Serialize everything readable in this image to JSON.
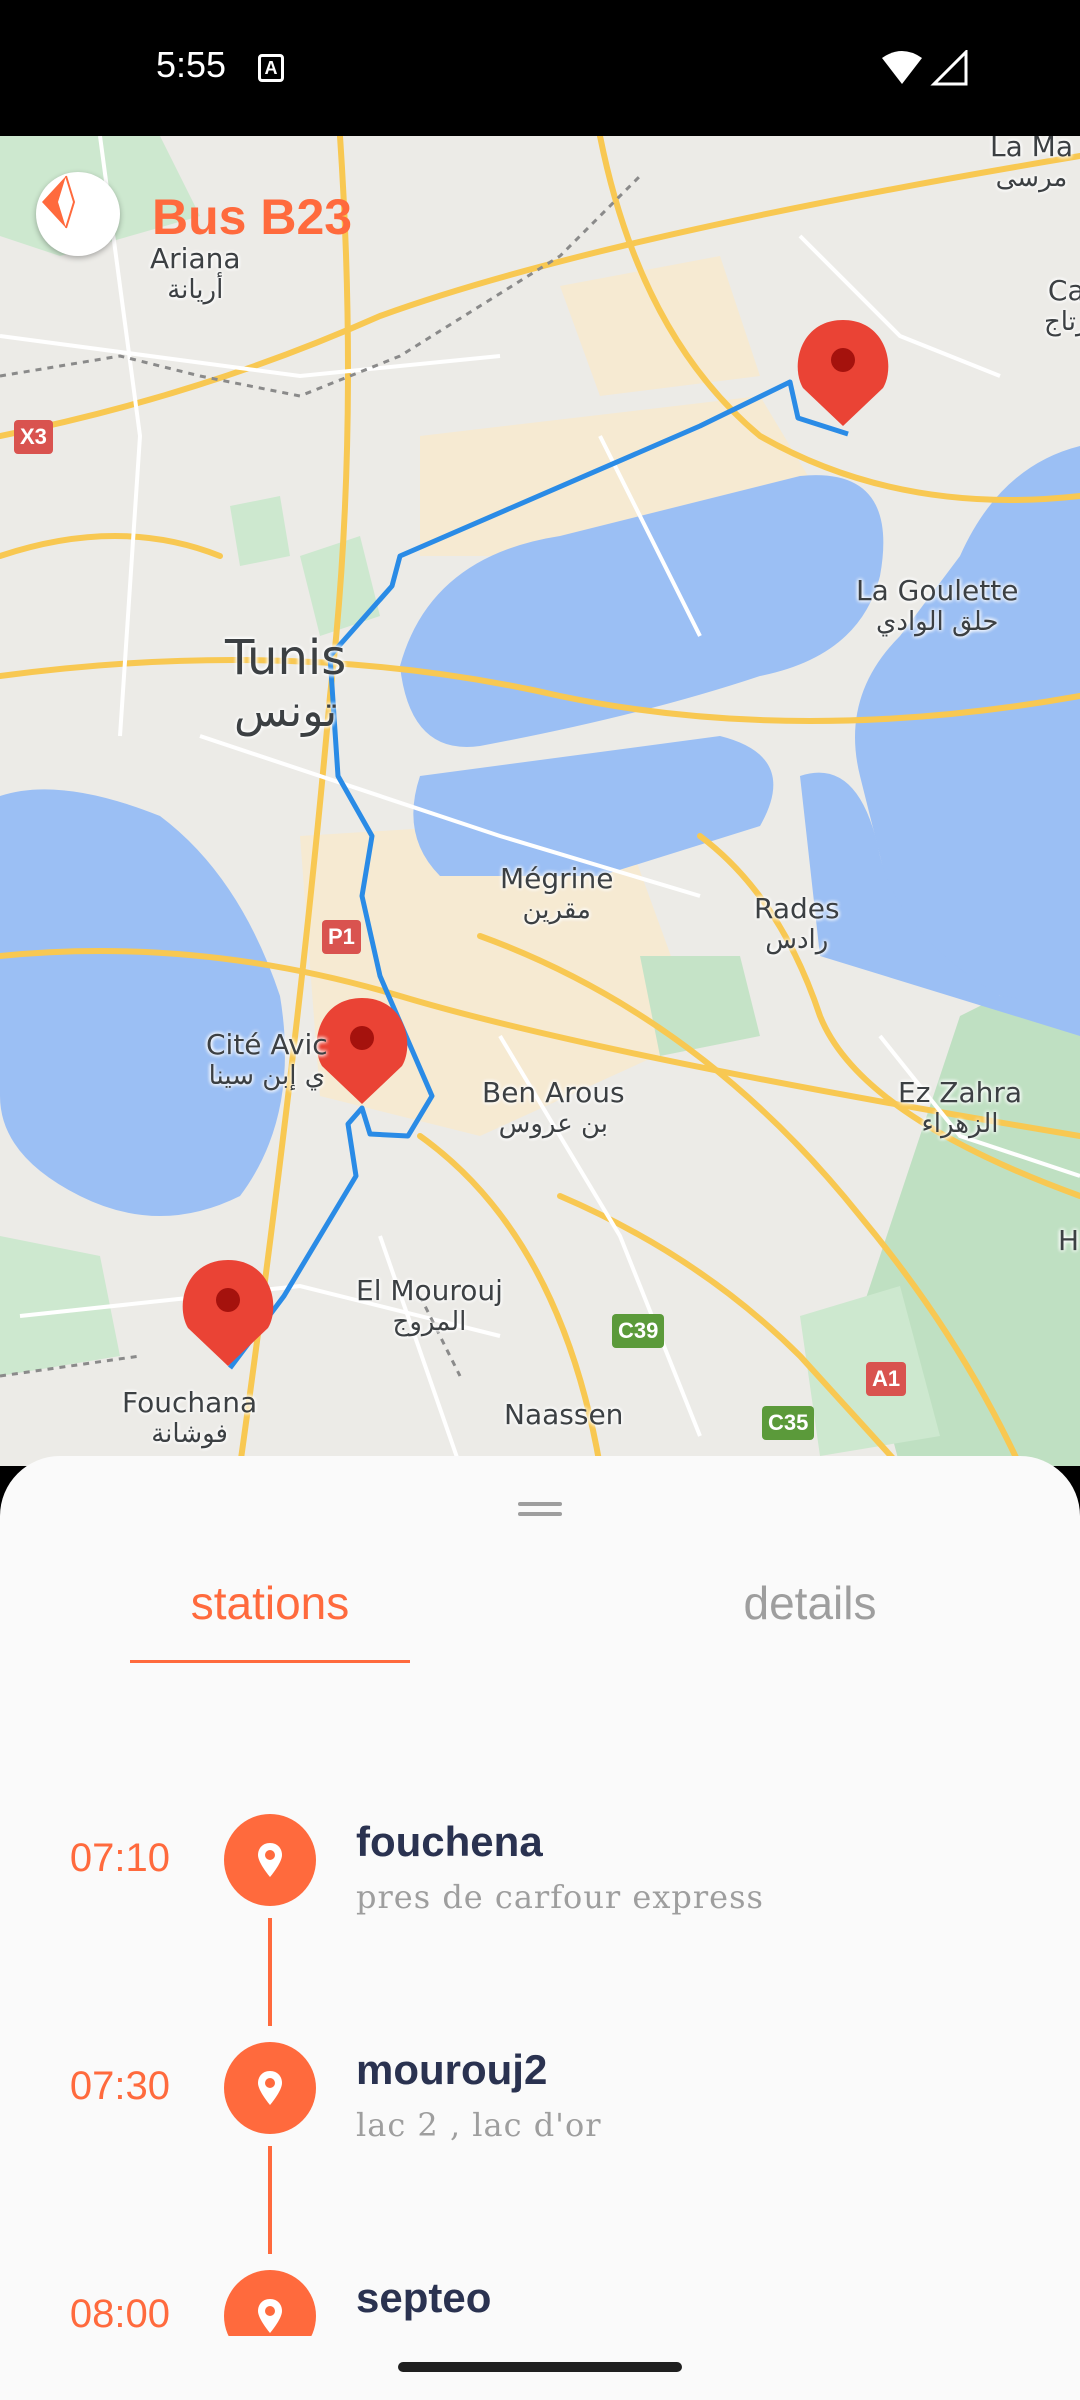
{
  "status_bar": {
    "time": "5:55",
    "notification_icon": "A"
  },
  "app": {
    "title": "Bus B23",
    "accent_color": "#ff6a3d"
  },
  "map": {
    "labels": {
      "ariana": {
        "latin": "Ariana",
        "arabic": "أريانة"
      },
      "tunis": {
        "latin": "Tunis",
        "arabic": "تونس"
      },
      "la_goulette": {
        "latin": "La Goulette",
        "arabic": "حلق الوادي"
      },
      "megrine": {
        "latin": "Mégrine",
        "arabic": "مقرين"
      },
      "rades": {
        "latin": "Rades",
        "arabic": "رادس"
      },
      "cite_avicenne": {
        "latin": "Cité Avic",
        "arabic": "ي إبن سينا"
      },
      "ben_arous": {
        "latin": "Ben Arous",
        "arabic": "بن عروس"
      },
      "ez_zahra": {
        "latin": "Ez Zahra",
        "arabic": "الزهراء"
      },
      "el_mourouj": {
        "latin": "El Mourouj",
        "arabic": "المروج"
      },
      "fouchana": {
        "latin": "Fouchana",
        "arabic": "فوشانة"
      },
      "naassen": {
        "latin": "Naassen",
        "arabic": ""
      },
      "la_marsa": {
        "latin": "La Ma",
        "arabic": "مرسى"
      },
      "carthage": {
        "latin": "Ca",
        "arabic": "رتاج"
      },
      "h_edge": {
        "latin": "H",
        "arabic": ""
      }
    },
    "badges": {
      "x3": "X3",
      "p1": "P1",
      "c39": "C39",
      "a1": "A1",
      "c35": "C35"
    }
  },
  "tabs": {
    "stations": "stations",
    "details": "details"
  },
  "stations": [
    {
      "time": "07:10",
      "name": "fouchena",
      "subtitle": "pres de carfour express"
    },
    {
      "time": "07:30",
      "name": "mourouj2",
      "subtitle": "lac 2 , lac d'or"
    },
    {
      "time": "08:00",
      "name": "septeo",
      "subtitle": ""
    }
  ]
}
